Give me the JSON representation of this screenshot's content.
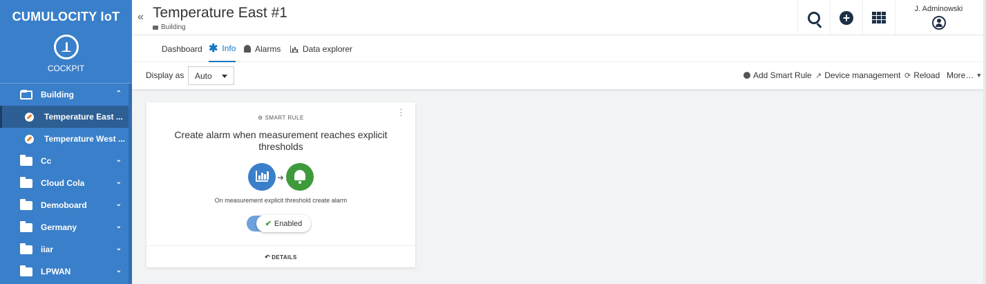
{
  "app": {
    "brand": "CUMULOCITY IoT",
    "name": "COCKPIT",
    "app_icon": "gauge-icon"
  },
  "header": {
    "collapse_glyph": "«",
    "title": "Temperature East #1",
    "breadcrumb": "Building",
    "user": "J. Adminowski"
  },
  "sidebar": {
    "groups": [
      {
        "label": "Building",
        "expanded": true,
        "children": [
          {
            "label": "Temperature East ...",
            "active": true
          },
          {
            "label": "Temperature West ...",
            "active": false
          }
        ]
      },
      {
        "label": "Cc"
      },
      {
        "label": "Cloud Cola"
      },
      {
        "label": "Demoboard"
      },
      {
        "label": "Germany"
      },
      {
        "label": "iiar"
      },
      {
        "label": "LPWAN"
      }
    ]
  },
  "tabs": [
    {
      "label": "Dashboard",
      "icon": "grid-icon",
      "active": false
    },
    {
      "label": "Info",
      "icon": "asterisk-icon",
      "active": true
    },
    {
      "label": "Alarms",
      "icon": "bell-icon",
      "active": false
    },
    {
      "label": "Data explorer",
      "icon": "bar-chart-icon",
      "active": false
    }
  ],
  "actionbar": {
    "display_label": "Display as",
    "display_value": "Auto",
    "actions": [
      {
        "label": "Add Smart Rule",
        "icon": "plus-circle-icon"
      },
      {
        "label": "Device management",
        "icon": "external-link-icon"
      },
      {
        "label": "Reload",
        "icon": "refresh-icon"
      },
      {
        "label": "More…",
        "icon": "caret-down-icon"
      }
    ]
  },
  "card": {
    "kicker": "SMART RULE",
    "title": "Create alarm when measurement reaches explicit thresholds",
    "description": "On measurement explicit threshold create alarm",
    "toggle_label": "Enabled",
    "toggle_state": true,
    "footer": "DETAILS"
  },
  "colors": {
    "sidebar": "#3a7fc9",
    "sidebar_active": "#2d5f94",
    "accent": "#1776bf",
    "measurement_circle": "#3a7fc9",
    "alarm_circle": "#3e9a3a"
  }
}
